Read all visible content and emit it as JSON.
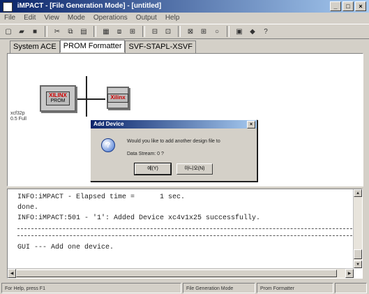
{
  "window": {
    "title": "iMPACT - [File Generation Mode] - [untitled]"
  },
  "menu": [
    "File",
    "Edit",
    "View",
    "Mode",
    "Operations",
    "Output",
    "Help"
  ],
  "toolbar": [
    "new-icon",
    "open-icon",
    "save-icon",
    "cut-icon",
    "copy-icon",
    "paste-icon",
    "device-icon",
    "chain-icon",
    "assign-icon",
    "program-icon",
    "verify-icon",
    "erase-icon",
    "config-icon",
    "readback-icon",
    "help-icon",
    "whatsthis-icon"
  ],
  "tabs": [
    "System ACE",
    "PROM Formatter",
    "SVF-STAPL-XSVF"
  ],
  "canvas": {
    "chip1": {
      "logo": "XILINX",
      "sub": "PROM"
    },
    "chip2": {
      "logo": "Xilinx"
    },
    "chip_label": "xcf32p\n0.5 Full"
  },
  "dialog": {
    "title": "Add Device",
    "question": "Would you like to add another design file to",
    "stream": "Data Stream: 0 ?",
    "yes": "예(Y)",
    "no": "아니오(N)"
  },
  "console": {
    "lines": [
      "INFO:iMPACT - Elapsed time =      1 sec.",
      "done.",
      "INFO:iMPACT:501 - '1': Added Device xc4v1x25 successfully.",
      "---",
      "---",
      "GUI --- Add one device."
    ]
  },
  "status": {
    "help": "For Help, press F1",
    "mode": "File Generation Mode",
    "tab": "Prom Formatter"
  }
}
